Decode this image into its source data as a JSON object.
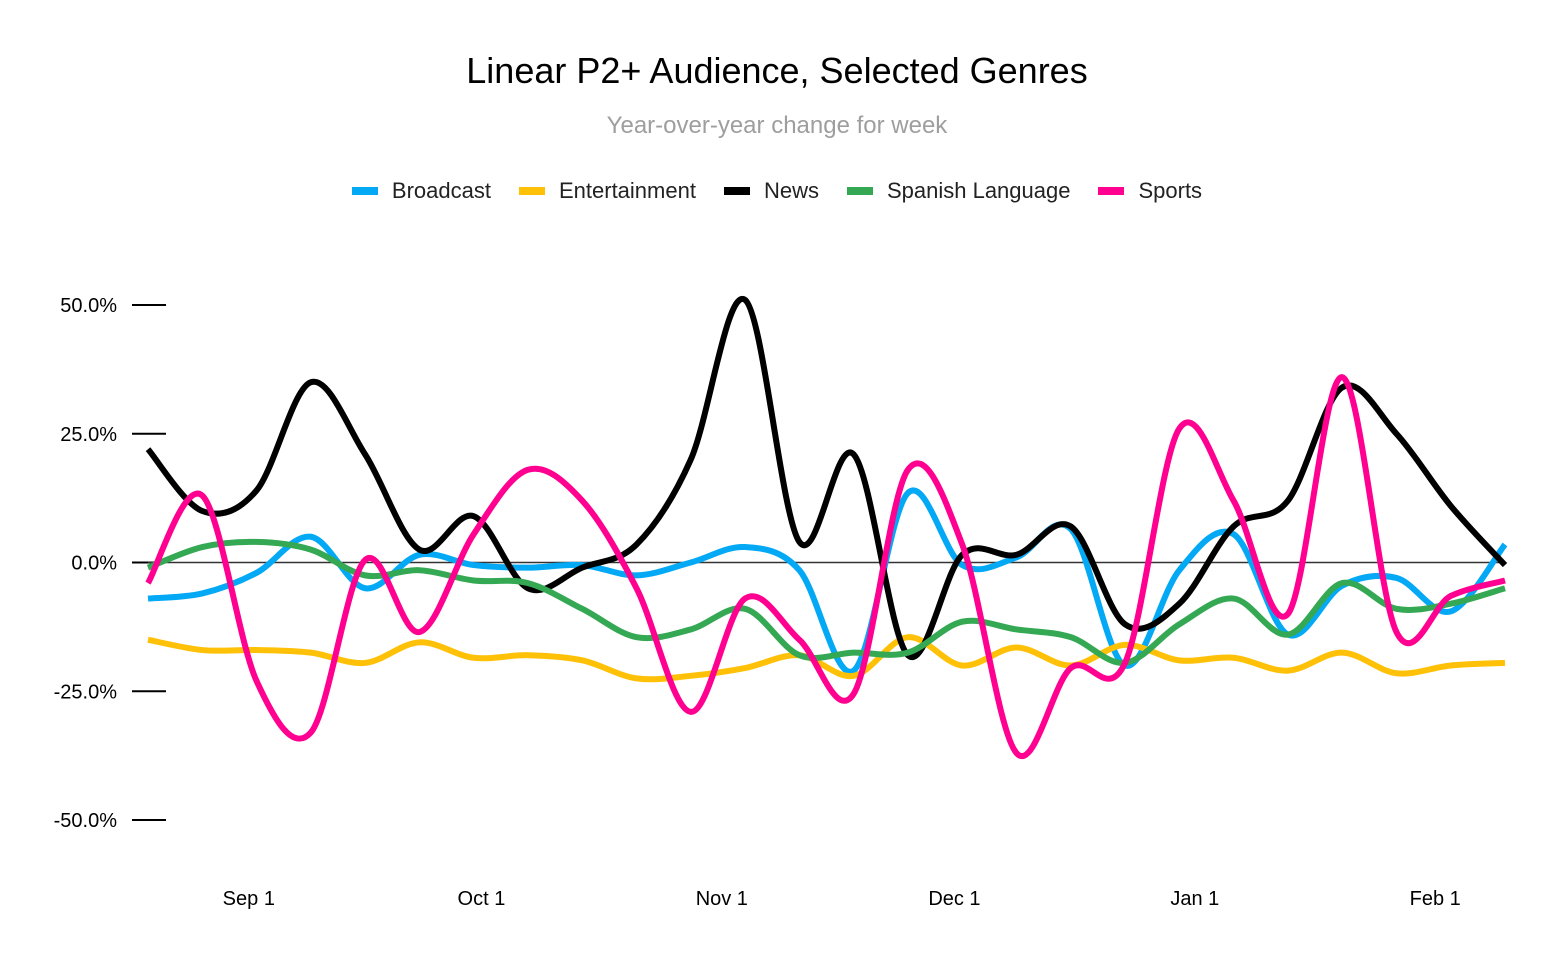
{
  "chart_data": {
    "type": "line",
    "title": "Linear P2+ Audience, Selected Genres",
    "subtitle": "Year-over-year change for week",
    "xlabel": "",
    "ylabel": "",
    "ylim": [
      -50,
      50
    ],
    "yticks": [
      50,
      25,
      0,
      -25,
      -50
    ],
    "ytick_labels": [
      "50.0%",
      "25.0%",
      "0.0%",
      "-25.0%",
      "-50.0%"
    ],
    "x_tick_labels": [
      "Sep 1",
      "Oct 1",
      "Nov 1",
      "Dec 1",
      "Jan 1",
      "Feb 1"
    ],
    "x_tick_days": [
      13,
      43,
      74,
      104,
      135,
      166
    ],
    "x_week_days": [
      0,
      7,
      14,
      21,
      28,
      35,
      42,
      49,
      56,
      63,
      70,
      77,
      84,
      91,
      98,
      105,
      112,
      119,
      126,
      133,
      140,
      147,
      154,
      161,
      168,
      175
    ],
    "legend_position": "top",
    "grid": false,
    "series": [
      {
        "name": "Broadcast",
        "color": "#03A9F4",
        "values": [
          -7,
          -6,
          -2,
          5,
          -5,
          1.5,
          -0.5,
          -1,
          -0.5,
          -2.5,
          0,
          3,
          -1.5,
          -21,
          13.5,
          -0.5,
          1,
          6.5,
          -20,
          -1.5,
          5.5,
          -14,
          -4.5,
          -3,
          -9.5,
          3.5
        ]
      },
      {
        "name": "Entertainment",
        "color": "#FFC107",
        "values": [
          -15,
          -17,
          -17,
          -17.5,
          -19.5,
          -15.5,
          -18.5,
          -18,
          -19,
          -22.5,
          -22,
          -20.5,
          -18,
          -22,
          -14.5,
          -20,
          -16.5,
          -20,
          -16,
          -19,
          -18.5,
          -21,
          -17.5,
          -21.5,
          -20,
          -19.5
        ]
      },
      {
        "name": "News",
        "color": "#000000",
        "values": [
          22,
          10,
          14,
          35,
          21,
          2.5,
          9,
          -5,
          -1,
          3.5,
          20,
          51,
          4,
          21,
          -18,
          1.5,
          1.5,
          7,
          -12,
          -8,
          7,
          12,
          34,
          25,
          11,
          -0.5
        ]
      },
      {
        "name": "Spanish Language",
        "color": "#34A853",
        "values": [
          -1,
          3,
          4,
          2.5,
          -2.5,
          -1.5,
          -3.5,
          -4,
          -9,
          -14.5,
          -13,
          -9,
          -18,
          -17.5,
          -17.5,
          -11.5,
          -13,
          -14.5,
          -19.5,
          -12,
          -7,
          -14,
          -4,
          -9,
          -8,
          -5
        ]
      },
      {
        "name": "Sports",
        "color": "#FF0090",
        "values": [
          -4,
          13,
          -23,
          -33,
          0.5,
          -13.5,
          5.5,
          18,
          12,
          -5,
          -29,
          -7,
          -15,
          -25.5,
          18,
          3.5,
          -37,
          -20.5,
          -19.5,
          26,
          12,
          -10,
          36,
          -13.5,
          -6.5,
          -3.5
        ]
      }
    ]
  }
}
